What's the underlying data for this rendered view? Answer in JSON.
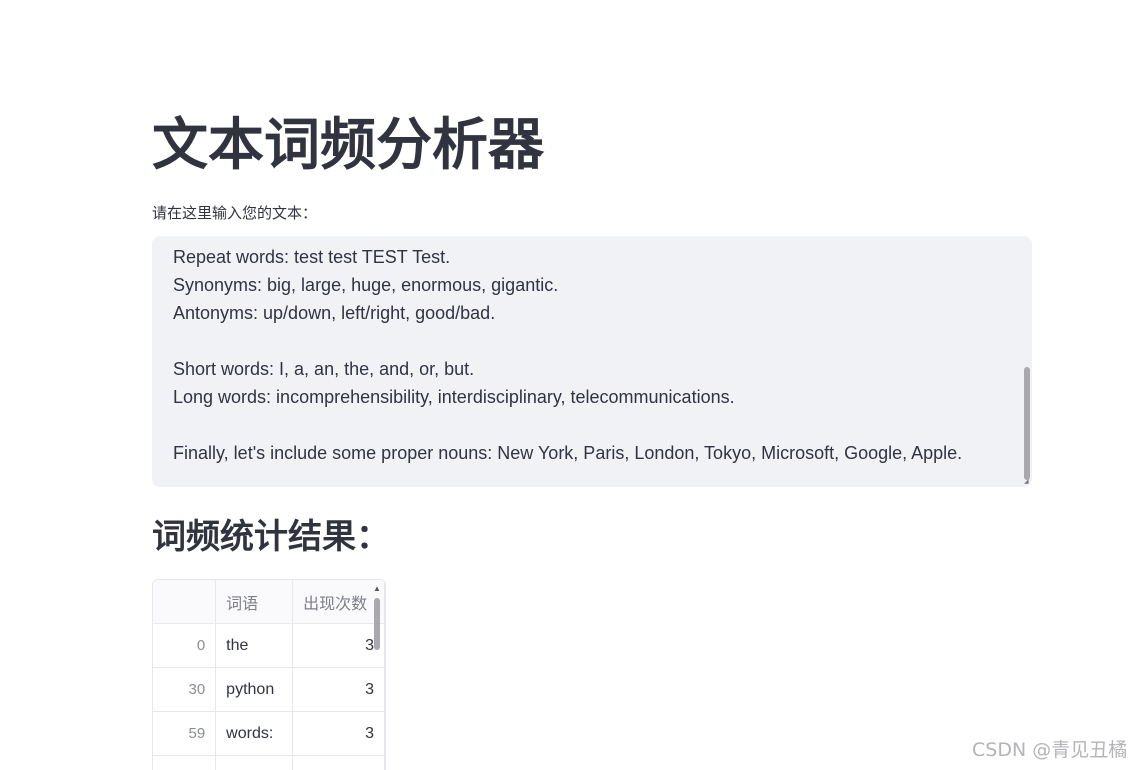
{
  "app": {
    "title": "文本词频分析器"
  },
  "input": {
    "label": "请在这里输入您的文本：",
    "lines": [
      "Repeat words: test test TEST Test.",
      "Synonyms: big, large, huge, enormous, gigantic.",
      "Antonyms: up/down, left/right, good/bad.",
      "",
      "Short words: I, a, an, the, and, or, but.",
      "Long words: incomprehensibility, interdisciplinary, telecommunications.",
      "",
      "Finally, let's include some proper nouns: New York, Paris, London, Tokyo, Microsoft, Google, Apple."
    ]
  },
  "results": {
    "title": "词频统计结果：",
    "columns": [
      "",
      "词语",
      "出现次数"
    ],
    "rows": [
      {
        "index": "0",
        "word": "the",
        "count": "3"
      },
      {
        "index": "30",
        "word": "python",
        "count": "3"
      },
      {
        "index": "59",
        "word": "words:",
        "count": "3"
      },
      {
        "index": "",
        "word": "",
        "count": ""
      }
    ]
  },
  "watermark": {
    "text": "CSDN @青见丑橘"
  }
}
